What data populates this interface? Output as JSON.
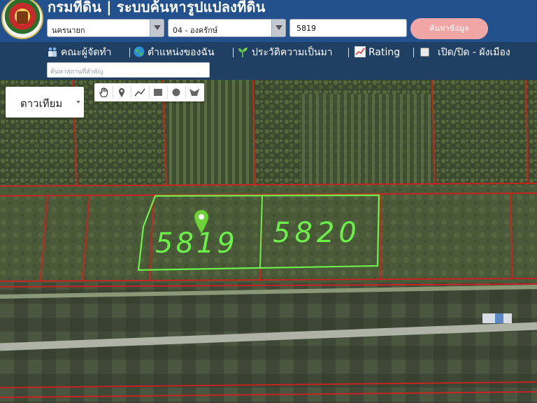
{
  "header": {
    "title": "กรมที่ดิน | ระบบค้นหารูปแปลงที่ดิน",
    "province_select": {
      "value": "นครนายก"
    },
    "district_select": {
      "value": "04 - องครักษ์"
    },
    "parcel_input": {
      "value": "5819"
    },
    "search_button": "ค้นหาข้อมูล"
  },
  "menu": {
    "items": [
      {
        "label": "คณะผู้จัดทำ",
        "icon": "team-icon"
      },
      {
        "label": "ตำแหน่งของฉัน",
        "icon": "globe-icon"
      },
      {
        "label": "ประวัติความเป็นมา",
        "icon": "sprout-icon"
      },
      {
        "label": "Rating",
        "icon": "chart-icon"
      },
      {
        "label": "เปิด/ปิด - ผังเมือง",
        "icon": "checkbox-icon"
      }
    ],
    "separator": "|",
    "place_search_placeholder": "ค้นหาสถานที่สำคัญ"
  },
  "map": {
    "map_type": "ดาวเทียม",
    "draw_tools": [
      "hand-icon",
      "marker-icon",
      "polyline-icon",
      "rectangle-icon",
      "circle-icon",
      "polygon-icon"
    ],
    "annotations": {
      "left_number": "5819",
      "right_number": "5820"
    },
    "colors": {
      "parcel_border": "#d22020",
      "annotation": "#6cf04a",
      "pin": "#6fd13a"
    }
  },
  "colors": {
    "header_bg": "#23518e",
    "menu_bg": "#1f3f63",
    "search_button_bg": "#f1a6a6"
  }
}
